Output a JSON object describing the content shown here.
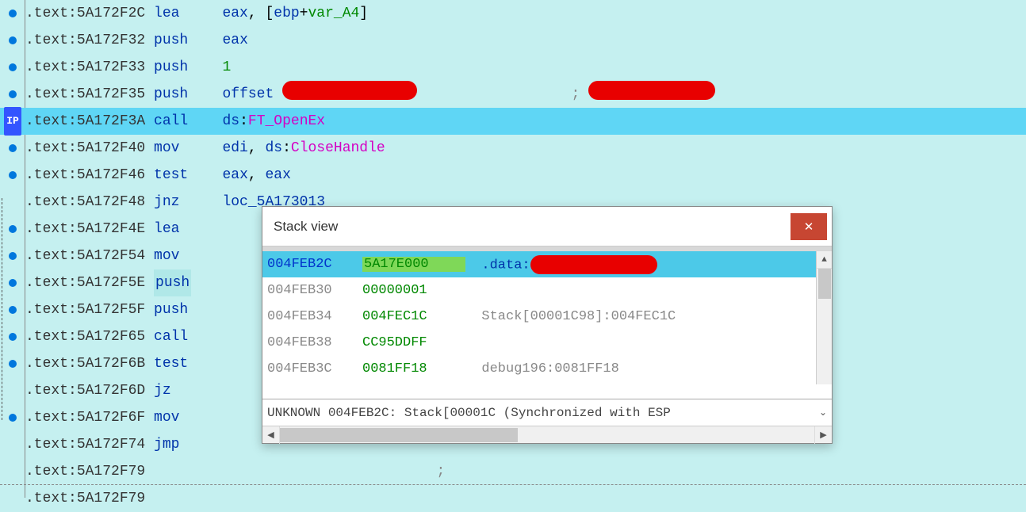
{
  "ip_label": "IP",
  "disasm": [
    {
      "dot": true,
      "seg": ".text:",
      "addr": "5A172F2C",
      "mn": "lea",
      "ops": [
        {
          "t": "reg",
          "v": "eax"
        },
        {
          "t": "text",
          "v": ", ["
        },
        {
          "t": "reg",
          "v": "ebp"
        },
        {
          "t": "text",
          "v": "+"
        },
        {
          "t": "var",
          "v": "var_A4"
        },
        {
          "t": "text",
          "v": "]"
        }
      ]
    },
    {
      "dot": true,
      "seg": ".text:",
      "addr": "5A172F32",
      "mn": "push",
      "ops": [
        {
          "t": "reg",
          "v": "eax"
        }
      ]
    },
    {
      "dot": true,
      "seg": ".text:",
      "addr": "5A172F33",
      "mn": "push",
      "ops": [
        {
          "t": "num",
          "v": "1"
        }
      ]
    },
    {
      "dot": true,
      "seg": ".text:",
      "addr": "5A172F35",
      "mn": "push",
      "ops": [
        {
          "t": "ptr",
          "v": "offset "
        }
      ],
      "redact_op": 170,
      "comment_prefix": ";",
      "redact_comment": 160
    },
    {
      "dot": false,
      "ip": true,
      "hl": true,
      "seg": ".text:",
      "addr": "5A172F3A",
      "mn": "call",
      "ops": [
        {
          "t": "ptr",
          "v": "ds"
        },
        {
          "t": "text",
          "v": ":"
        },
        {
          "t": "extern",
          "v": "FT_OpenEx"
        }
      ]
    },
    {
      "dot": true,
      "seg": ".text:",
      "addr": "5A172F40",
      "mn": "mov",
      "ops": [
        {
          "t": "reg",
          "v": "edi"
        },
        {
          "t": "text",
          "v": ", "
        },
        {
          "t": "ptr",
          "v": "ds"
        },
        {
          "t": "text",
          "v": ":"
        },
        {
          "t": "extern",
          "v": "CloseHandle"
        }
      ]
    },
    {
      "dot": true,
      "seg": ".text:",
      "addr": "5A172F46",
      "mn": "test",
      "ops": [
        {
          "t": "reg",
          "v": "eax"
        },
        {
          "t": "text",
          "v": ", "
        },
        {
          "t": "reg",
          "v": "eax"
        }
      ]
    },
    {
      "dot": false,
      "seg": ".text:",
      "addr": "5A172F48",
      "mn": "jnz",
      "ops": [
        {
          "t": "label",
          "v": "loc_5A173013"
        }
      ]
    },
    {
      "dot": true,
      "seg": ".text:",
      "addr": "5A172F4E",
      "mn": "lea",
      "ops": []
    },
    {
      "dot": true,
      "seg": ".text:",
      "addr": "5A172F54",
      "mn": "mov",
      "ops": []
    },
    {
      "dot": true,
      "hl_mn": true,
      "seg": ".text:",
      "addr": "5A172F5E",
      "mn": "push",
      "ops": []
    },
    {
      "dot": true,
      "seg": ".text:",
      "addr": "5A172F5F",
      "mn": "push",
      "ops": []
    },
    {
      "dot": true,
      "seg": ".text:",
      "addr": "5A172F65",
      "mn": "call",
      "ops": []
    },
    {
      "dot": true,
      "seg": ".text:",
      "addr": "5A172F6B",
      "mn": "test",
      "ops": []
    },
    {
      "dot": false,
      "seg": ".text:",
      "addr": "5A172F6D",
      "mn": "jz",
      "ops": []
    },
    {
      "dot": true,
      "seg": ".text:",
      "addr": "5A172F6F",
      "mn": "mov",
      "ops": []
    },
    {
      "dot": false,
      "seg": ".text:",
      "addr": "5A172F74",
      "mn": "jmp",
      "ops": []
    },
    {
      "dot": false,
      "dashed_after": true,
      "seg": ".text:",
      "addr": "5A172F79",
      "mn": "",
      "comment_prefix": ";",
      "ops": []
    },
    {
      "dot": false,
      "seg": ".text:",
      "addr": "5A172F79",
      "mn": "",
      "ops": []
    }
  ],
  "stack": {
    "title": "Stack view",
    "rows": [
      {
        "sel": true,
        "addr": "004FEB2C",
        "val": "5A17E000",
        "val_hl": true,
        "desc_prefix": ".data:",
        "redact": 160
      },
      {
        "addr": "004FEB30",
        "val": "00000001"
      },
      {
        "addr": "004FEB34",
        "val": "004FEC1C",
        "desc": "Stack[00001C98]:004FEC1C"
      },
      {
        "addr": "004FEB38",
        "val": "CC95DDFF"
      },
      {
        "addr": "004FEB3C",
        "val": "0081FF18",
        "desc": "debug196:0081FF18"
      }
    ],
    "status": "UNKNOWN 004FEB2C: Stack[00001C (Synchronized with ESP"
  }
}
